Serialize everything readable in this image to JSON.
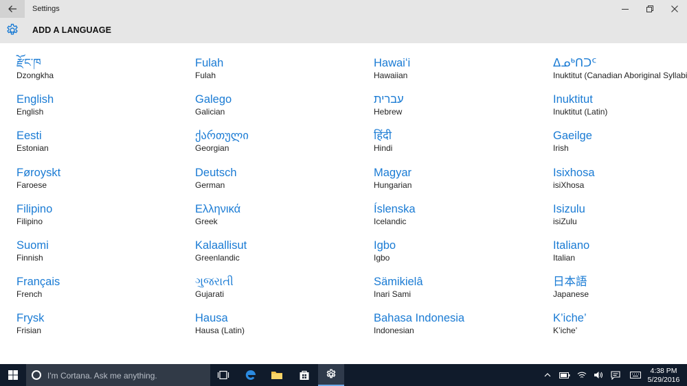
{
  "window": {
    "title": "Settings"
  },
  "header": {
    "title": "ADD A LANGUAGE"
  },
  "columns": [
    [
      {
        "native": "རྫོང་ཁ",
        "english": "Dzongkha"
      },
      {
        "native": "English",
        "english": "English"
      },
      {
        "native": "Eesti",
        "english": "Estonian"
      },
      {
        "native": "Føroyskt",
        "english": "Faroese"
      },
      {
        "native": "Filipino",
        "english": "Filipino"
      },
      {
        "native": "Suomi",
        "english": "Finnish"
      },
      {
        "native": "Français",
        "english": "French"
      },
      {
        "native": "Frysk",
        "english": "Frisian"
      }
    ],
    [
      {
        "native": "Fulah",
        "english": "Fulah"
      },
      {
        "native": "Galego",
        "english": "Galician"
      },
      {
        "native": "ქართული",
        "english": "Georgian"
      },
      {
        "native": "Deutsch",
        "english": "German"
      },
      {
        "native": "Ελληνικά",
        "english": "Greek"
      },
      {
        "native": "Kalaallisut",
        "english": "Greenlandic"
      },
      {
        "native": "ગુજરાતી",
        "english": "Gujarati"
      },
      {
        "native": "Hausa",
        "english": "Hausa (Latin)"
      }
    ],
    [
      {
        "native": "Hawaiʻi",
        "english": "Hawaiian"
      },
      {
        "native": "עברית",
        "english": "Hebrew"
      },
      {
        "native": "हिंदी",
        "english": "Hindi"
      },
      {
        "native": "Magyar",
        "english": "Hungarian"
      },
      {
        "native": "Íslenska",
        "english": "Icelandic"
      },
      {
        "native": "Igbo",
        "english": "Igbo"
      },
      {
        "native": "Sämikielâ",
        "english": "Inari Sami"
      },
      {
        "native": "Bahasa Indonesia",
        "english": "Indonesian"
      }
    ],
    [
      {
        "native": "ᐃᓄᒃᑎᑐᑦ",
        "english": "Inuktitut (Canadian Aboriginal Syllabics)"
      },
      {
        "native": "Inuktitut",
        "english": "Inuktitut (Latin)"
      },
      {
        "native": "Gaeilge",
        "english": "Irish"
      },
      {
        "native": "Isixhosa",
        "english": "isiXhosa"
      },
      {
        "native": "Isizulu",
        "english": "isiZulu"
      },
      {
        "native": "Italiano",
        "english": "Italian"
      },
      {
        "native": "日本語",
        "english": "Japanese"
      },
      {
        "native": "K’iche’",
        "english": "K’iche’"
      }
    ]
  ],
  "taskbar": {
    "search_placeholder": "I'm Cortana. Ask me anything.",
    "time": "4:38 PM",
    "date": "5/29/2016"
  },
  "colors": {
    "accent": "#1a7bd4",
    "chrome": "#e6e6e6",
    "taskbar": "#101b2b"
  }
}
